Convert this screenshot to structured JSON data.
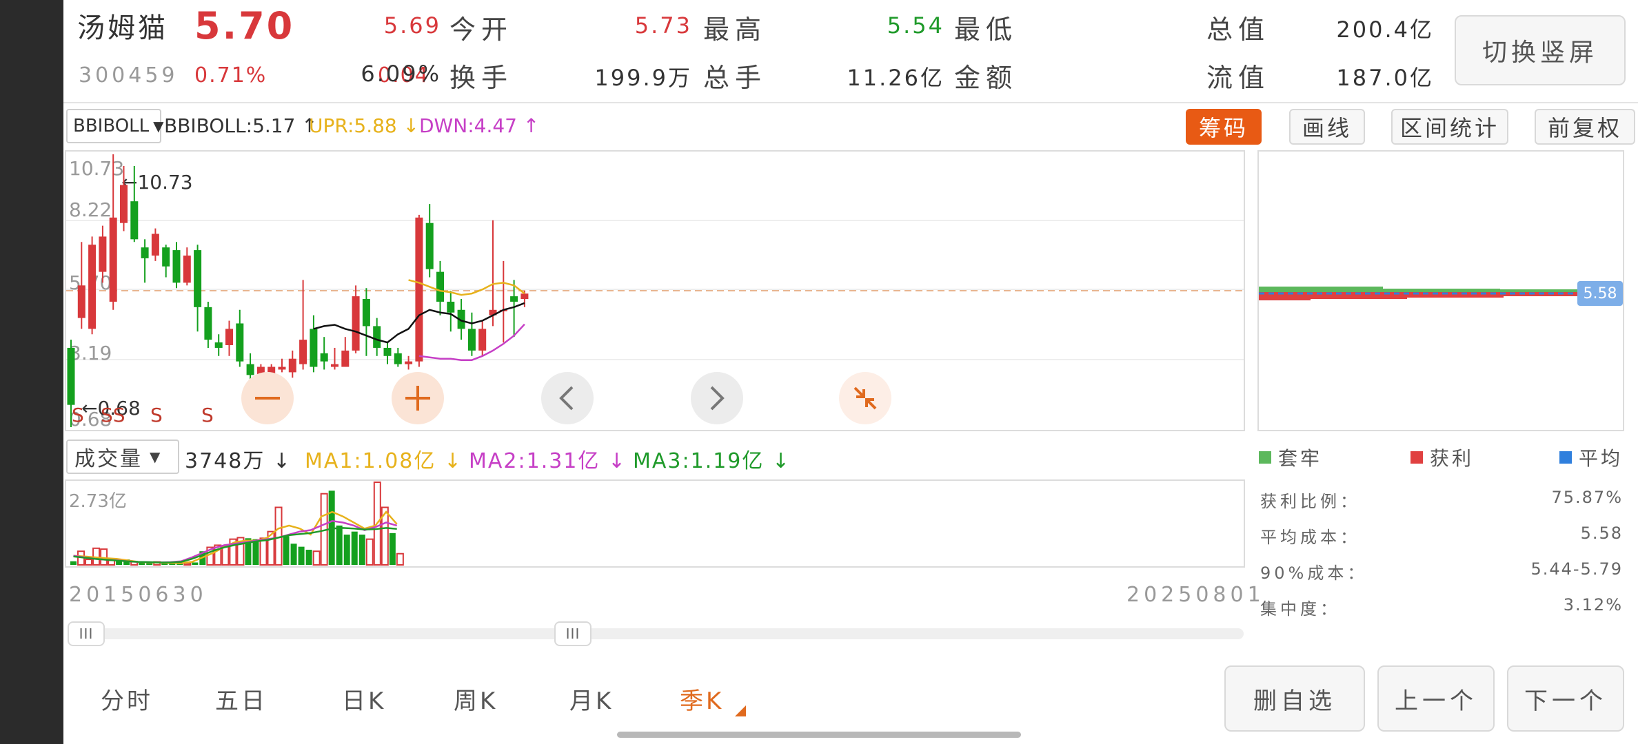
{
  "header": {
    "name": "汤姆猫",
    "price": "5.70",
    "code": "300459",
    "change_pct": "0.71%",
    "change": "0.04",
    "quotes": [
      {
        "label": "今开",
        "value": "5.69",
        "color": "red"
      },
      {
        "label": "最高",
        "value": "5.73",
        "color": "red"
      },
      {
        "label": "最低",
        "value": "5.54",
        "color": "green"
      },
      {
        "label": "总值",
        "value": "200.4亿",
        "color": "dark"
      },
      {
        "label": "换手",
        "value": "6.09%",
        "color": "dark"
      },
      {
        "label": "总手",
        "value": "199.9万",
        "color": "dark"
      },
      {
        "label": "金额",
        "value": "11.26亿",
        "color": "dark"
      },
      {
        "label": "流值",
        "value": "187.0亿",
        "color": "dark"
      }
    ],
    "switch_label": "切换竖屏"
  },
  "indicator": {
    "selected": "BBIBOLL",
    "items": [
      {
        "text": "BBIBOLL:5.17 ↑",
        "color": "#333333"
      },
      {
        "text": "UPR:5.88 ↓",
        "color": "#e7b21c"
      },
      {
        "text": "DWN:4.47 ↑",
        "color": "#c63fc6"
      }
    ]
  },
  "tools": [
    "筹码",
    "画线",
    "区间统计",
    "前复权"
  ],
  "kline": {
    "y_labels": [
      "10.73",
      "8.22",
      "5.70",
      "3.19",
      "0.68"
    ],
    "max_annot": "←10.73",
    "min_annot": "←0.68",
    "s_marks": [
      "S",
      "SS",
      "S",
      "S",
      "S"
    ],
    "candles": [
      {
        "o": 3.6,
        "c": 1.5,
        "h": 3.9,
        "l": 0.68
      },
      {
        "o": 4.7,
        "c": 5.9,
        "h": 7.5,
        "l": 4.3
      },
      {
        "o": 4.3,
        "c": 7.4,
        "h": 7.7,
        "l": 4.1
      },
      {
        "o": 6.4,
        "c": 7.7,
        "h": 8.1,
        "l": 6.0
      },
      {
        "o": 5.3,
        "c": 8.4,
        "h": 10.73,
        "l": 5.0
      },
      {
        "o": 8.2,
        "c": 9.6,
        "h": 10.3,
        "l": 7.9
      },
      {
        "o": 9.0,
        "c": 7.6,
        "h": 10.3,
        "l": 7.5
      },
      {
        "o": 7.3,
        "c": 6.9,
        "h": 7.6,
        "l": 6.0
      },
      {
        "o": 7.0,
        "c": 7.8,
        "h": 8.0,
        "l": 6.8
      },
      {
        "o": 7.3,
        "c": 6.6,
        "h": 7.4,
        "l": 6.2
      },
      {
        "o": 7.2,
        "c": 6.0,
        "h": 7.5,
        "l": 5.8
      },
      {
        "o": 6.0,
        "c": 7.0,
        "h": 7.3,
        "l": 5.9
      },
      {
        "o": 7.2,
        "c": 5.1,
        "h": 7.4,
        "l": 4.2
      },
      {
        "o": 5.1,
        "c": 3.9,
        "h": 5.3,
        "l": 3.6
      },
      {
        "o": 3.8,
        "c": 3.6,
        "h": 4.1,
        "l": 3.3
      },
      {
        "o": 3.7,
        "c": 4.3,
        "h": 4.6,
        "l": 3.3
      },
      {
        "o": 4.5,
        "c": 3.1,
        "h": 5.0,
        "l": 2.9
      },
      {
        "o": 3.0,
        "c": 2.6,
        "h": 3.4,
        "l": 2.3
      },
      {
        "o": 2.6,
        "c": 2.9,
        "h": 3.0,
        "l": 2.4
      },
      {
        "o": 2.6,
        "c": 2.9,
        "h": 3.0,
        "l": 2.5
      },
      {
        "o": 2.8,
        "c": 2.9,
        "h": 3.2,
        "l": 2.7
      },
      {
        "o": 2.7,
        "c": 3.2,
        "h": 3.5,
        "l": 2.5
      },
      {
        "o": 3.0,
        "c": 3.9,
        "h": 6.1,
        "l": 2.8
      },
      {
        "o": 4.3,
        "c": 2.9,
        "h": 4.8,
        "l": 2.7
      },
      {
        "o": 3.4,
        "c": 3.1,
        "h": 4.0,
        "l": 2.8
      },
      {
        "o": 2.9,
        "c": 3.0,
        "h": 3.6,
        "l": 2.8
      },
      {
        "o": 2.9,
        "c": 3.5,
        "h": 4.0,
        "l": 2.9
      },
      {
        "o": 3.5,
        "c": 5.5,
        "h": 5.9,
        "l": 3.4
      },
      {
        "o": 5.4,
        "c": 4.4,
        "h": 5.8,
        "l": 3.3
      },
      {
        "o": 4.4,
        "c": 3.6,
        "h": 4.7,
        "l": 3.3
      },
      {
        "o": 3.6,
        "c": 3.3,
        "h": 3.8,
        "l": 3.0
      },
      {
        "o": 3.4,
        "c": 3.0,
        "h": 3.6,
        "l": 2.9
      },
      {
        "o": 3.0,
        "c": 3.1,
        "h": 3.3,
        "l": 2.8
      },
      {
        "o": 3.1,
        "c": 8.4,
        "h": 8.5,
        "l": 2.9
      },
      {
        "o": 8.2,
        "c": 6.5,
        "h": 8.9,
        "l": 6.2
      },
      {
        "o": 6.4,
        "c": 5.3,
        "h": 6.8,
        "l": 4.8
      },
      {
        "o": 5.3,
        "c": 4.9,
        "h": 5.7,
        "l": 4.2
      },
      {
        "o": 5.0,
        "c": 4.3,
        "h": 5.4,
        "l": 3.9
      },
      {
        "o": 4.3,
        "c": 3.5,
        "h": 4.9,
        "l": 3.3
      },
      {
        "o": 3.5,
        "c": 4.3,
        "h": 4.6,
        "l": 3.3
      },
      {
        "o": 4.8,
        "c": 5.0,
        "h": 8.3,
        "l": 4.4
      },
      {
        "o": 5.0,
        "c": 5.0,
        "h": 6.8,
        "l": 3.8
      },
      {
        "o": 5.5,
        "c": 5.3,
        "h": 6.1,
        "l": 4.0
      },
      {
        "o": 5.4,
        "c": 5.6,
        "h": 5.7,
        "l": 5.1
      }
    ],
    "bbi": [
      4.3,
      4.4,
      4.45,
      4.3,
      4.2,
      4.05,
      3.9,
      3.8,
      4.1,
      4.3,
      4.8,
      5.0,
      4.9,
      4.85,
      4.6,
      4.5,
      4.6,
      4.8,
      5.0,
      5.1,
      5.25
    ],
    "upr": [
      6.1,
      6.0,
      5.85,
      5.7,
      5.65,
      5.55,
      5.6,
      5.75,
      5.95,
      6.0,
      5.9,
      5.6
    ],
    "dwn": [
      3.3,
      3.25,
      3.2,
      3.2,
      3.15,
      3.15,
      3.3,
      3.5,
      3.75,
      4.05,
      4.47
    ]
  },
  "nav_buttons": [
    {
      "name": "zoom-out-button",
      "symbol": "−"
    },
    {
      "name": "zoom-in-button",
      "symbol": "+"
    },
    {
      "name": "scroll-left-button",
      "symbol": "‹"
    },
    {
      "name": "scroll-right-button",
      "symbol": "›"
    },
    {
      "name": "collapse-button",
      "symbol": "⤡"
    }
  ],
  "volume": {
    "selected": "成交量",
    "current": "3748万 ↓",
    "ma": [
      {
        "text": "MA1:1.08亿 ↓",
        "color": "#e7b21c"
      },
      {
        "text": "MA2:1.31亿 ↓",
        "color": "#c63fc6"
      },
      {
        "text": "MA3:1.19亿 ↓",
        "color": "#1f9a2a"
      }
    ],
    "y_max_label": "2.73亿",
    "bars": [
      0.12,
      0.45,
      0.18,
      0.55,
      0.52,
      0.15,
      0.12,
      0.18,
      0.1,
      0.1,
      0.08,
      0.1,
      0.05,
      0.04,
      0.04,
      0.05,
      0.08,
      0.45,
      0.58,
      0.65,
      0.62,
      0.85,
      0.9,
      0.88,
      0.85,
      0.88,
      1.1,
      1.9,
      0.95,
      0.7,
      0.6,
      0.5,
      0.45,
      2.35,
      2.45,
      1.3,
      1.0,
      1.1,
      1.0,
      0.85,
      2.73,
      1.9,
      1.05,
      0.37
    ],
    "ma1": [
      0.3,
      0.28,
      0.25,
      0.22,
      0.2,
      0.15,
      0.1,
      0.08,
      0.07,
      0.06,
      0.06,
      0.1,
      0.25,
      0.4,
      0.6,
      0.75,
      0.8,
      0.8,
      0.9,
      1.2,
      1.3,
      1.2,
      1.0,
      1.6,
      1.75,
      1.6,
      1.4,
      1.2,
      1.3,
      1.75,
      1.35
    ],
    "ma2": [
      0.3,
      0.25,
      0.2,
      0.17,
      0.15,
      0.12,
      0.1,
      0.09,
      0.08,
      0.09,
      0.12,
      0.25,
      0.4,
      0.55,
      0.65,
      0.7,
      0.75,
      0.8,
      0.85,
      0.9,
      1.0,
      1.1,
      1.15,
      1.3,
      1.45,
      1.4,
      1.3,
      1.15,
      1.25,
      1.4,
      1.3
    ],
    "ma3": [
      0.28,
      0.24,
      0.2,
      0.17,
      0.14,
      0.12,
      0.1,
      0.09,
      0.08,
      0.08,
      0.1,
      0.2,
      0.33,
      0.47,
      0.58,
      0.66,
      0.72,
      0.78,
      0.82,
      0.9,
      0.98,
      1.02,
      1.05,
      1.12,
      1.2,
      1.22,
      1.2,
      1.17,
      1.18,
      1.22,
      1.19
    ]
  },
  "dates": {
    "start": "20150630",
    "end": "20250801"
  },
  "slider": {
    "handle_symbol": "III",
    "window_start": 0.0,
    "window_end": 0.43
  },
  "chip": {
    "price_label": "5.58",
    "legend": [
      {
        "label": "套牢",
        "color": "#5cb85c"
      },
      {
        "label": "获利",
        "color": "#e04040"
      },
      {
        "label": "平均",
        "color": "#2f7fdd"
      }
    ],
    "stats": [
      {
        "label": "获利比例：",
        "value": "75.87%"
      },
      {
        "label": "平均成本：",
        "value": "5.58"
      },
      {
        "label": "90%成本：",
        "value": "5.44-5.79"
      },
      {
        "label": "集中度：",
        "value": "3.12%"
      }
    ]
  },
  "periods": [
    {
      "label": "分时",
      "active": false
    },
    {
      "label": "五日",
      "active": false
    },
    {
      "label": "日K",
      "active": false
    },
    {
      "label": "周K",
      "active": false
    },
    {
      "label": "月K",
      "active": false
    },
    {
      "label": "季K",
      "active": true
    }
  ],
  "actions": [
    "删自选",
    "上一个",
    "下一个"
  ]
}
